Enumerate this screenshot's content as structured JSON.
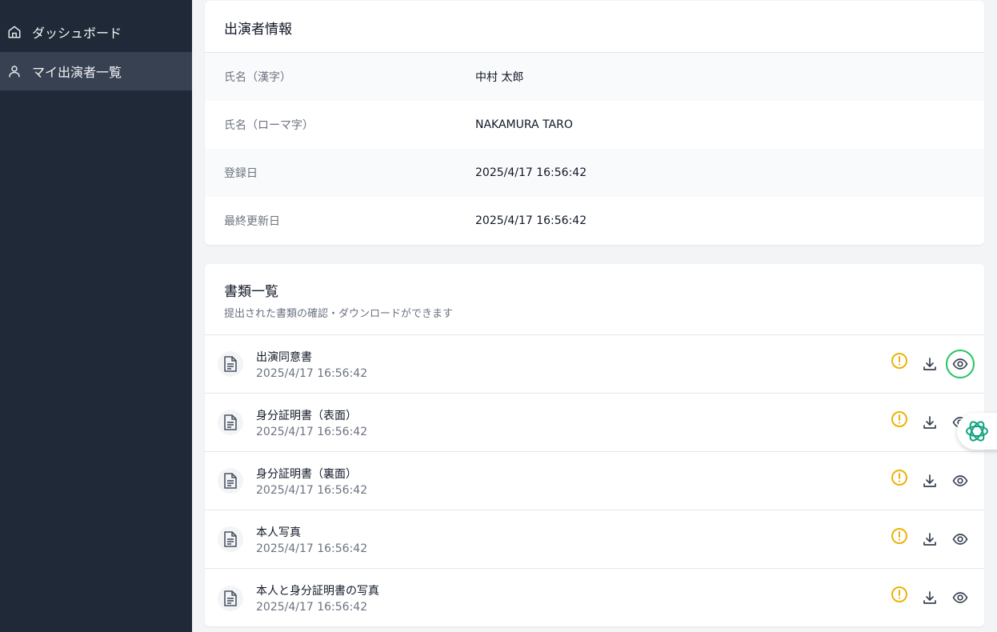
{
  "sidebar": {
    "items": [
      {
        "label": "ダッシュボード",
        "icon": "home-icon"
      },
      {
        "label": "マイ出演者一覧",
        "icon": "user-icon",
        "active": true
      }
    ]
  },
  "performer_info": {
    "title": "出演者情報",
    "rows": [
      {
        "label": "氏名（漢字）",
        "value": "中村 太郎"
      },
      {
        "label": "氏名（ローマ字）",
        "value": "NAKAMURA TARO"
      },
      {
        "label": "登録日",
        "value": "2025/4/17 16:56:42"
      },
      {
        "label": "最終更新日",
        "value": "2025/4/17 16:56:42"
      }
    ]
  },
  "documents": {
    "title": "書類一覧",
    "subtitle": "提出された書類の確認・ダウンロードができます",
    "items": [
      {
        "name": "出演同意書",
        "date": "2025/4/17 16:56:42"
      },
      {
        "name": "身分証明書（表面）",
        "date": "2025/4/17 16:56:42"
      },
      {
        "name": "身分証明書（裏面）",
        "date": "2025/4/17 16:56:42"
      },
      {
        "name": "本人写真",
        "date": "2025/4/17 16:56:42"
      },
      {
        "name": "本人と身分証明書の写真",
        "date": "2025/4/17 16:56:42"
      }
    ]
  },
  "colors": {
    "sidebar_bg": "#1f2937",
    "warning": "#eab308",
    "focus_ring": "#22c55e",
    "assistant_icon": "#10a37f"
  },
  "floating_button": {
    "icon": "assistant-icon"
  }
}
